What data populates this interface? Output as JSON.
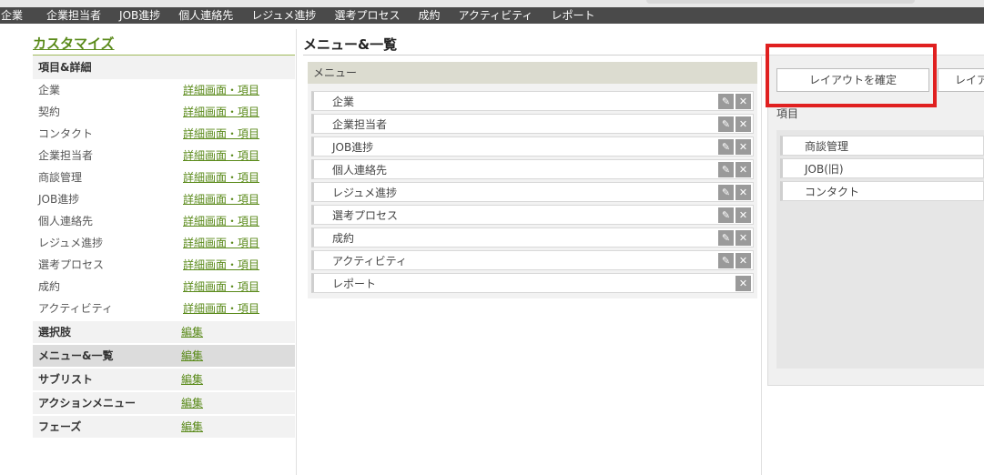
{
  "topnav": {
    "items": [
      "企業",
      "企業担当者",
      "JOB進捗",
      "個人連絡先",
      "レジュメ進捗",
      "選考プロセス",
      "成約",
      "アクティビティ",
      "レポート"
    ]
  },
  "sidebar": {
    "title": "カスタマイズ",
    "section_header": "項目&詳細",
    "detail_link": "詳細画面・項目",
    "detail_items": [
      "企業",
      "契約",
      "コンタクト",
      "企業担当者",
      "商談管理",
      "JOB進捗",
      "個人連絡先",
      "レジュメ進捗",
      "選考プロセス",
      "成約",
      "アクティビティ"
    ],
    "edit_link": "編集",
    "bold_items": [
      "選択肢",
      "メニュー&一覧",
      "サブリスト",
      "アクションメニュー",
      "フェーズ"
    ]
  },
  "main": {
    "title": "メニュー&一覧",
    "menu_header": "メニュー",
    "menu_items": [
      "企業",
      "企業担当者",
      "JOB進捗",
      "個人連絡先",
      "レジュメ進捗",
      "選考プロセス",
      "成約",
      "アクティビティ",
      "レポート"
    ],
    "edit_icon_glyph": "✎",
    "delete_icon_glyph": "✕"
  },
  "right": {
    "confirm_button": "レイアウトを確定",
    "second_button": "レイア",
    "items_label": "項目",
    "items": [
      "商談管理",
      "JOB(旧)",
      "コンタクト"
    ]
  }
}
